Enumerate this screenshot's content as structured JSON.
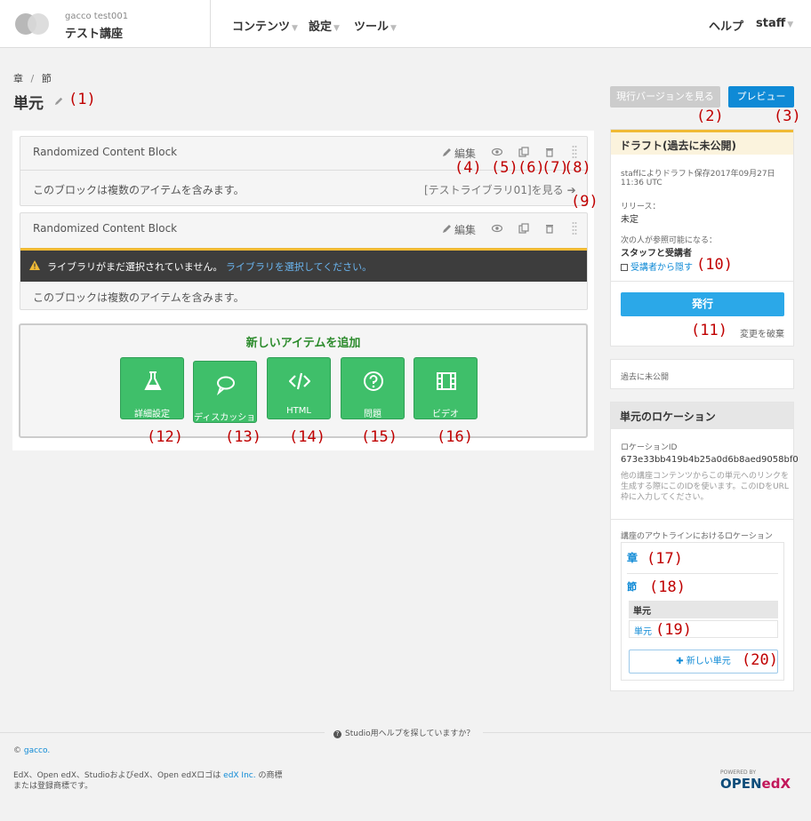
{
  "header": {
    "course_org": "gacco test001",
    "course_title": "テスト講座",
    "nav": [
      "コンテンツ",
      "設定",
      "ツール"
    ],
    "help": "ヘルプ",
    "user": "staff"
  },
  "breadcrumb": {
    "chapter": "章",
    "sep": "/",
    "section": "節"
  },
  "page_title": "単元",
  "buttons": {
    "view_current": "現行バージョンを見る",
    "preview": "プレビュー"
  },
  "blocks": [
    {
      "title": "Randomized Content Block",
      "edit_label": "編集",
      "body_text": "このブロックは複数のアイテムを含みます。",
      "library_link": "[テストライブラリ01]を見る"
    },
    {
      "title": "Randomized Content Block",
      "edit_label": "編集",
      "warning_text": "ライブラリがまだ選択されていません。",
      "warning_link": "ライブラリを選択してください。",
      "body_text": "このブロックは複数のアイテムを含みます。"
    }
  ],
  "add_new": {
    "title": "新しいアイテムを追加",
    "buttons": [
      "詳細設定",
      "ディスカッション",
      "HTML",
      "問題",
      "ビデオ"
    ]
  },
  "sidebar": {
    "draft_title": "ドラフト(過去に未公開)",
    "draft_saved": "staffによりドラフト保存2017年09月27日",
    "draft_time": "11:36 UTC",
    "release_label": "リリース：",
    "release_value": "未定",
    "visible_label": "次の人が参照可能になる：",
    "visible_value": "スタッフと受講者",
    "hide_label": "受講者から隠す",
    "publish": "発行",
    "discard": "変更を破棄",
    "never_published": "過去に未公開",
    "location_title": "単元のロケーション",
    "location_id_label": "ロケーションID",
    "location_id": "673e33bb419b4b25a0d6b8aed9058bf0",
    "location_help": [
      "他の講座コンテンツからこの単元へのリンクを",
      "生成する際にこのIDを使います。このIDをURL",
      "枠に入力してください。"
    ],
    "outline_label": "講座のアウトラインにおけるロケーション",
    "outline_chapter": "章",
    "outline_section": "節",
    "outline_unit_header": "単元",
    "outline_unit": "単元",
    "new_unit": "新しい単元"
  },
  "callouts": [
    "(1)",
    "(2)",
    "(3)",
    "(4)",
    "(5)",
    "(6)",
    "(7)",
    "(8)",
    "(9)",
    "(10)",
    "(11)",
    "(12)",
    "(13)",
    "(14)",
    "(15)",
    "(16)",
    "(17)",
    "(18)",
    "(19)",
    "(20)"
  ],
  "footer": {
    "help_text": "Studio用ヘルプを探していますか？",
    "copyright_prefix": "©",
    "copyright_link": "gacco.",
    "trademark_1a": "EdX、Open edX、StudioおよびedX、Open edXロゴは",
    "trademark_link": "edX Inc.",
    "trademark_1b": "の商標",
    "trademark_2": "または登録商標です。",
    "powered_by": "POWERED BY",
    "brand_open": "OPEN",
    "brand_edx": "edX"
  },
  "colors": {
    "accent_blue": "#0f8ad6",
    "green": "#3fbf6a",
    "warning_yellow": "#f0ba35",
    "callout_red": "#c00000"
  }
}
